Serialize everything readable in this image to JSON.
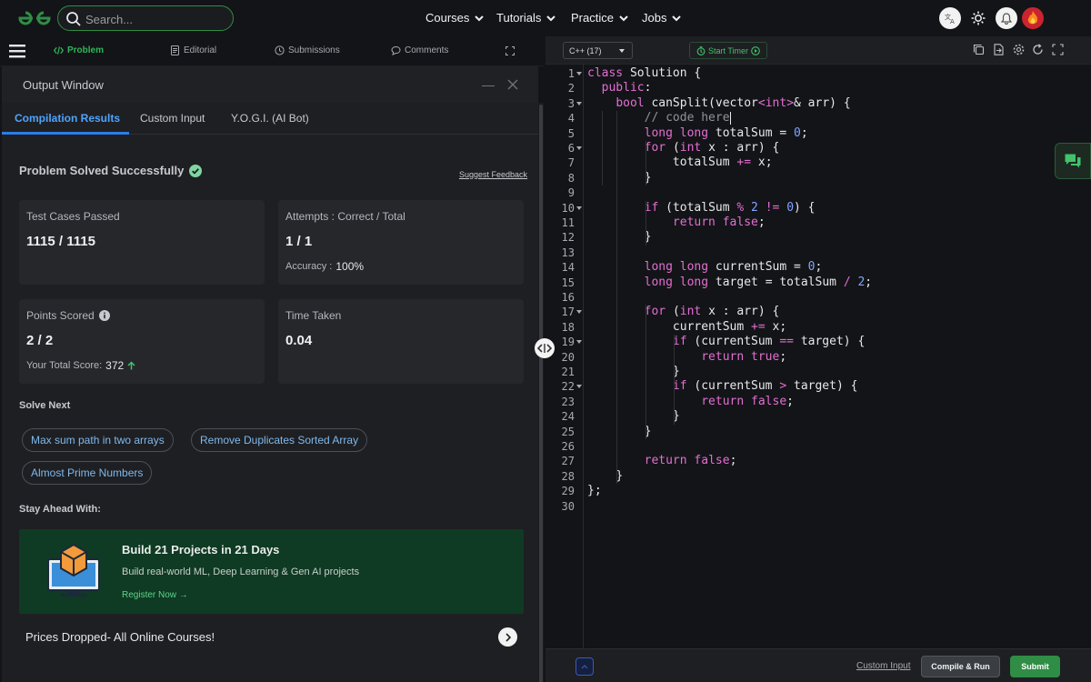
{
  "colors": {
    "brand_green": "#2f8d46",
    "accent_blue": "#2b7de9",
    "success": "#41c26b"
  },
  "nav": {
    "search_placeholder": "Search...",
    "links": [
      "Courses",
      "Tutorials",
      "Practice",
      "Jobs"
    ]
  },
  "left_tabs": [
    "Problem",
    "Editorial",
    "Submissions",
    "Comments"
  ],
  "output": {
    "title": "Output Window",
    "tabs": [
      "Compilation Results",
      "Custom Input",
      "Y.O.G.I. (AI Bot)"
    ],
    "status": "Problem Solved Successfully",
    "feedback": "Suggest Feedback",
    "cards": {
      "tests_label": "Test Cases Passed",
      "tests_value": "1115 / 1115",
      "attempts_label": "Attempts : Correct / Total",
      "attempts_value": "1 / 1",
      "accuracy_label": "Accuracy :",
      "accuracy_value": "100%",
      "points_label": "Points Scored",
      "points_value": "2 / 2",
      "total_score_label": "Your Total Score:",
      "total_score_value": "372",
      "time_label": "Time Taken",
      "time_value": "0.04"
    },
    "solve_next_label": "Solve Next",
    "solve_next": [
      "Max sum path in two arrays",
      "Remove Duplicates Sorted Array",
      "Almost Prime Numbers"
    ],
    "stay_ahead_label": "Stay Ahead With:",
    "promo": {
      "title": "Build 21 Projects in 21 Days",
      "desc": "Build real-world ML, Deep Learning & Gen AI projects",
      "cta": "Register Now →"
    },
    "prices": "Prices Dropped- All Online Courses!"
  },
  "editor": {
    "language": "C++ (17)",
    "timer": "Start Timer",
    "lines": [
      "class Solution {",
      "  public:",
      "    bool canSplit(vector<int>& arr) {",
      "        // code here",
      "        long long totalSum = 0;",
      "        for (int x : arr) {",
      "            totalSum += x;",
      "        }",
      "",
      "        if (totalSum % 2 != 0) {",
      "            return false;",
      "        }",
      "",
      "        long long currentSum = 0;",
      "        long long target = totalSum / 2;",
      "",
      "        for (int x : arr) {",
      "            currentSum += x;",
      "            if (currentSum == target) {",
      "                return true;",
      "            }",
      "            if (currentSum > target) {",
      "                return false;",
      "            }",
      "        }",
      "",
      "        return false;",
      "    }",
      "};",
      ""
    ],
    "custom_input": "Custom Input",
    "compile": "Compile & Run",
    "submit": "Submit"
  }
}
